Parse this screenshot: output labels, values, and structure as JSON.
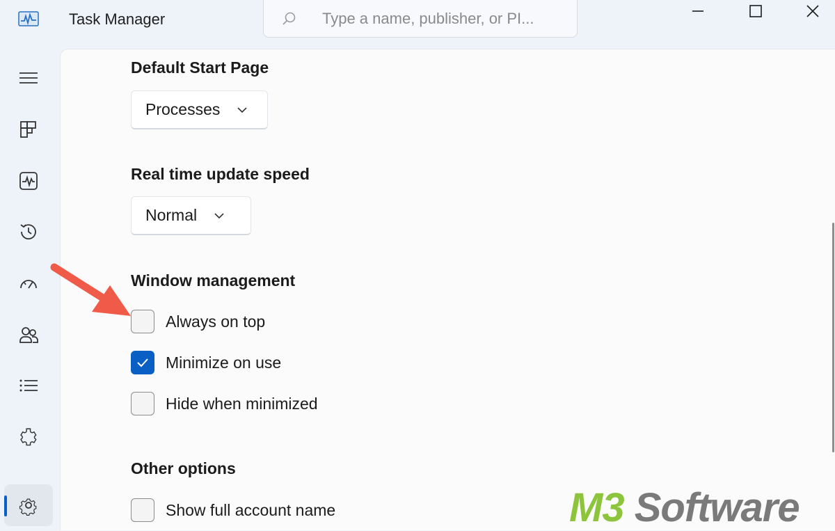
{
  "window": {
    "title": "Task Manager",
    "search_placeholder": "Type a name, publisher, or PI..."
  },
  "nav": {
    "items": [
      {
        "icon": "hamburger-menu-icon"
      },
      {
        "icon": "processes-icon"
      },
      {
        "icon": "performance-icon"
      },
      {
        "icon": "app-history-icon"
      },
      {
        "icon": "startup-apps-icon"
      },
      {
        "icon": "users-icon"
      },
      {
        "icon": "details-icon"
      },
      {
        "icon": "services-icon"
      },
      {
        "icon": "settings-gear-icon",
        "selected": true
      }
    ]
  },
  "settings": {
    "default_start_page": {
      "heading": "Default Start Page",
      "value": "Processes"
    },
    "update_speed": {
      "heading": "Real time update speed",
      "value": "Normal"
    },
    "window_management": {
      "heading": "Window management",
      "options": [
        {
          "label": "Always on top",
          "checked": false
        },
        {
          "label": "Minimize on use",
          "checked": true
        },
        {
          "label": "Hide when minimized",
          "checked": false
        }
      ]
    },
    "other_options": {
      "heading": "Other options",
      "options": [
        {
          "label": "Show full account name",
          "checked": false
        }
      ]
    }
  },
  "colors": {
    "accent": "#0a5fc4",
    "annotation_arrow": "#f05a48",
    "watermark_brand": "#8cc43c",
    "watermark_text": "#7a7a7a"
  },
  "watermark": {
    "brand": "M3",
    "rest": " Software"
  }
}
